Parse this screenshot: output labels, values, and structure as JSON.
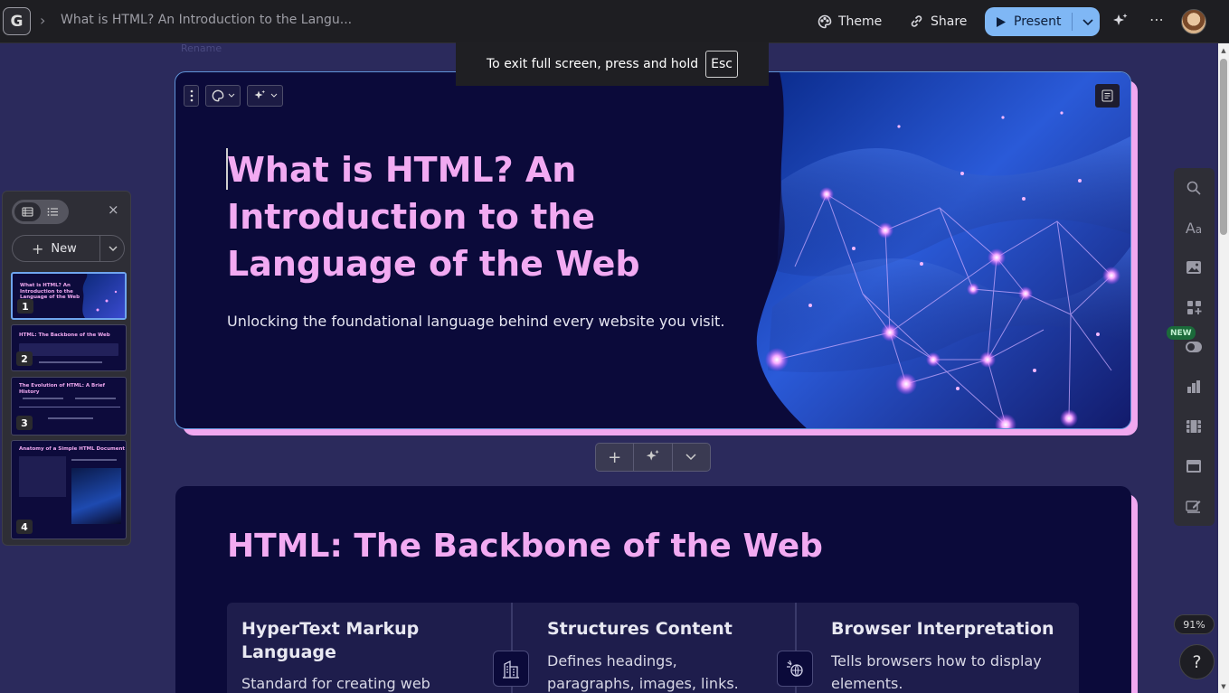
{
  "topbar": {
    "logo_letter": "G",
    "doc_title": "What is HTML? An Introduction to the Langu...",
    "rename_hint": "Rename",
    "theme_label": "Theme",
    "share_label": "Share",
    "present_label": "Present",
    "more_label": "⋯",
    "present_color": "#7fb7f5"
  },
  "toast": {
    "message": "To exit full screen, press and hold",
    "key": "Esc"
  },
  "left_panel": {
    "new_label": "New",
    "close_label": "×",
    "slides": [
      {
        "number": "1",
        "title": "What is HTML? An\nIntroduction to the\nLanguage of the Web"
      },
      {
        "number": "2",
        "title": "HTML: The Backbone of the Web"
      },
      {
        "number": "3",
        "title": "The Evolution of HTML: A Brief History"
      },
      {
        "number": "4",
        "title": "Anatomy of a Simple HTML Document"
      }
    ]
  },
  "slide1": {
    "title": "What is HTML? An Introduction to the Language of the Web",
    "subtitle": "Unlocking the foundational language behind every website you visit.",
    "accent_color": "#f2aaf2",
    "background_color": "#0b0a3a"
  },
  "add_bar": {
    "plus": "+",
    "dropdown": "⌄"
  },
  "slide2": {
    "title": "HTML: The Backbone of the Web",
    "cards": [
      {
        "title": "HyperText Markup Language",
        "desc": "Standard for creating web",
        "icon": "building-icon"
      },
      {
        "title": "Structures Content",
        "desc": "Defines headings, paragraphs, images, links.",
        "icon": "globe-icon"
      },
      {
        "title": "Browser Interpretation",
        "desc": "Tells browsers how to display elements.",
        "icon": "none"
      }
    ]
  },
  "right_rail": {
    "new_badge": "NEW",
    "zoom": "91%",
    "help": "?"
  }
}
